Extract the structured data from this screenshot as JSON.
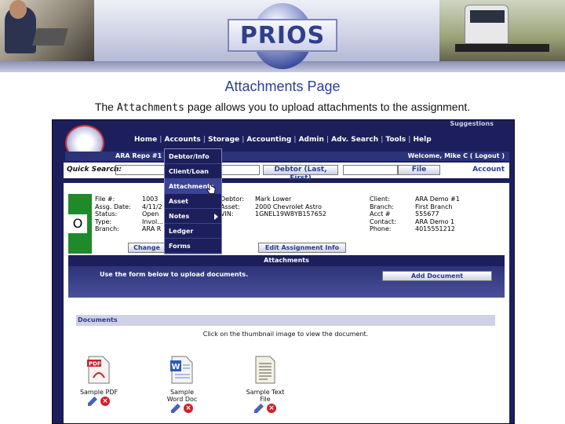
{
  "banner": {
    "logo_text": "PRIOS"
  },
  "page": {
    "title": "Attachments Page",
    "subtitle_prefix": "The ",
    "subtitle_mono": "Attachments",
    "subtitle_suffix": " page allows you to upload attachments to the assignment."
  },
  "app": {
    "suggestions": "Suggestions",
    "nav": [
      "Home",
      "Accounts",
      "Storage",
      "Accounting",
      "Admin",
      "Adv. Search",
      "Tools",
      "Help"
    ],
    "userbar": {
      "repo": "ARA Repo #1",
      "welcome": "Welcome, Mike C ( Logout )"
    },
    "search": {
      "label": "Quick Search:",
      "button_debtor": "Debtor (Last, First)",
      "button_file": "File",
      "account": "Account"
    },
    "menu": [
      "Debtor/Info",
      "Client/Loan",
      "Attachments",
      "Asset",
      "Notes",
      "Ledger",
      "Forms"
    ],
    "status_letter": "O",
    "info": {
      "labels1": [
        "File #:",
        "Assg. Date:",
        "Status:",
        "Type:",
        "Branch:"
      ],
      "values1": [
        "1003",
        "4/11/2",
        "Open",
        "Invol...",
        "ARA R"
      ],
      "labels2": [
        "Debtor:",
        "Asset:",
        "VIN:"
      ],
      "values2": [
        "Mark Lower",
        "2000 Chevrolet Astro",
        "1GNEL19W8YB157652"
      ],
      "labels3": [
        "Client:",
        "Branch:",
        "Acct #",
        "Contact:",
        "Phone:"
      ],
      "values3": [
        "ARA Demo #1",
        "First Branch",
        "555677",
        "ARA Demo 1",
        "4015551212"
      ]
    },
    "buttons": {
      "change": "Change",
      "edit_assignment": "Edit Assignment Info"
    },
    "section_title": "Attachments",
    "upload_text": "Use the form below to upload documents.",
    "add_document": "Add Document",
    "documents_header": "Documents",
    "documents_hint": "Click on the thumbnail image to view the document.",
    "documents": [
      {
        "name": "Sample PDF",
        "icon": "pdf-icon"
      },
      {
        "name": "Sample Word Doc",
        "icon": "word-icon"
      },
      {
        "name": "Sample Text File",
        "icon": "text-file-icon"
      }
    ]
  },
  "colors": {
    "navy": "#1c1f5c",
    "title_blue": "#2c3e9c",
    "status_green": "#1f8a2a",
    "delete_red": "#d0212d"
  }
}
